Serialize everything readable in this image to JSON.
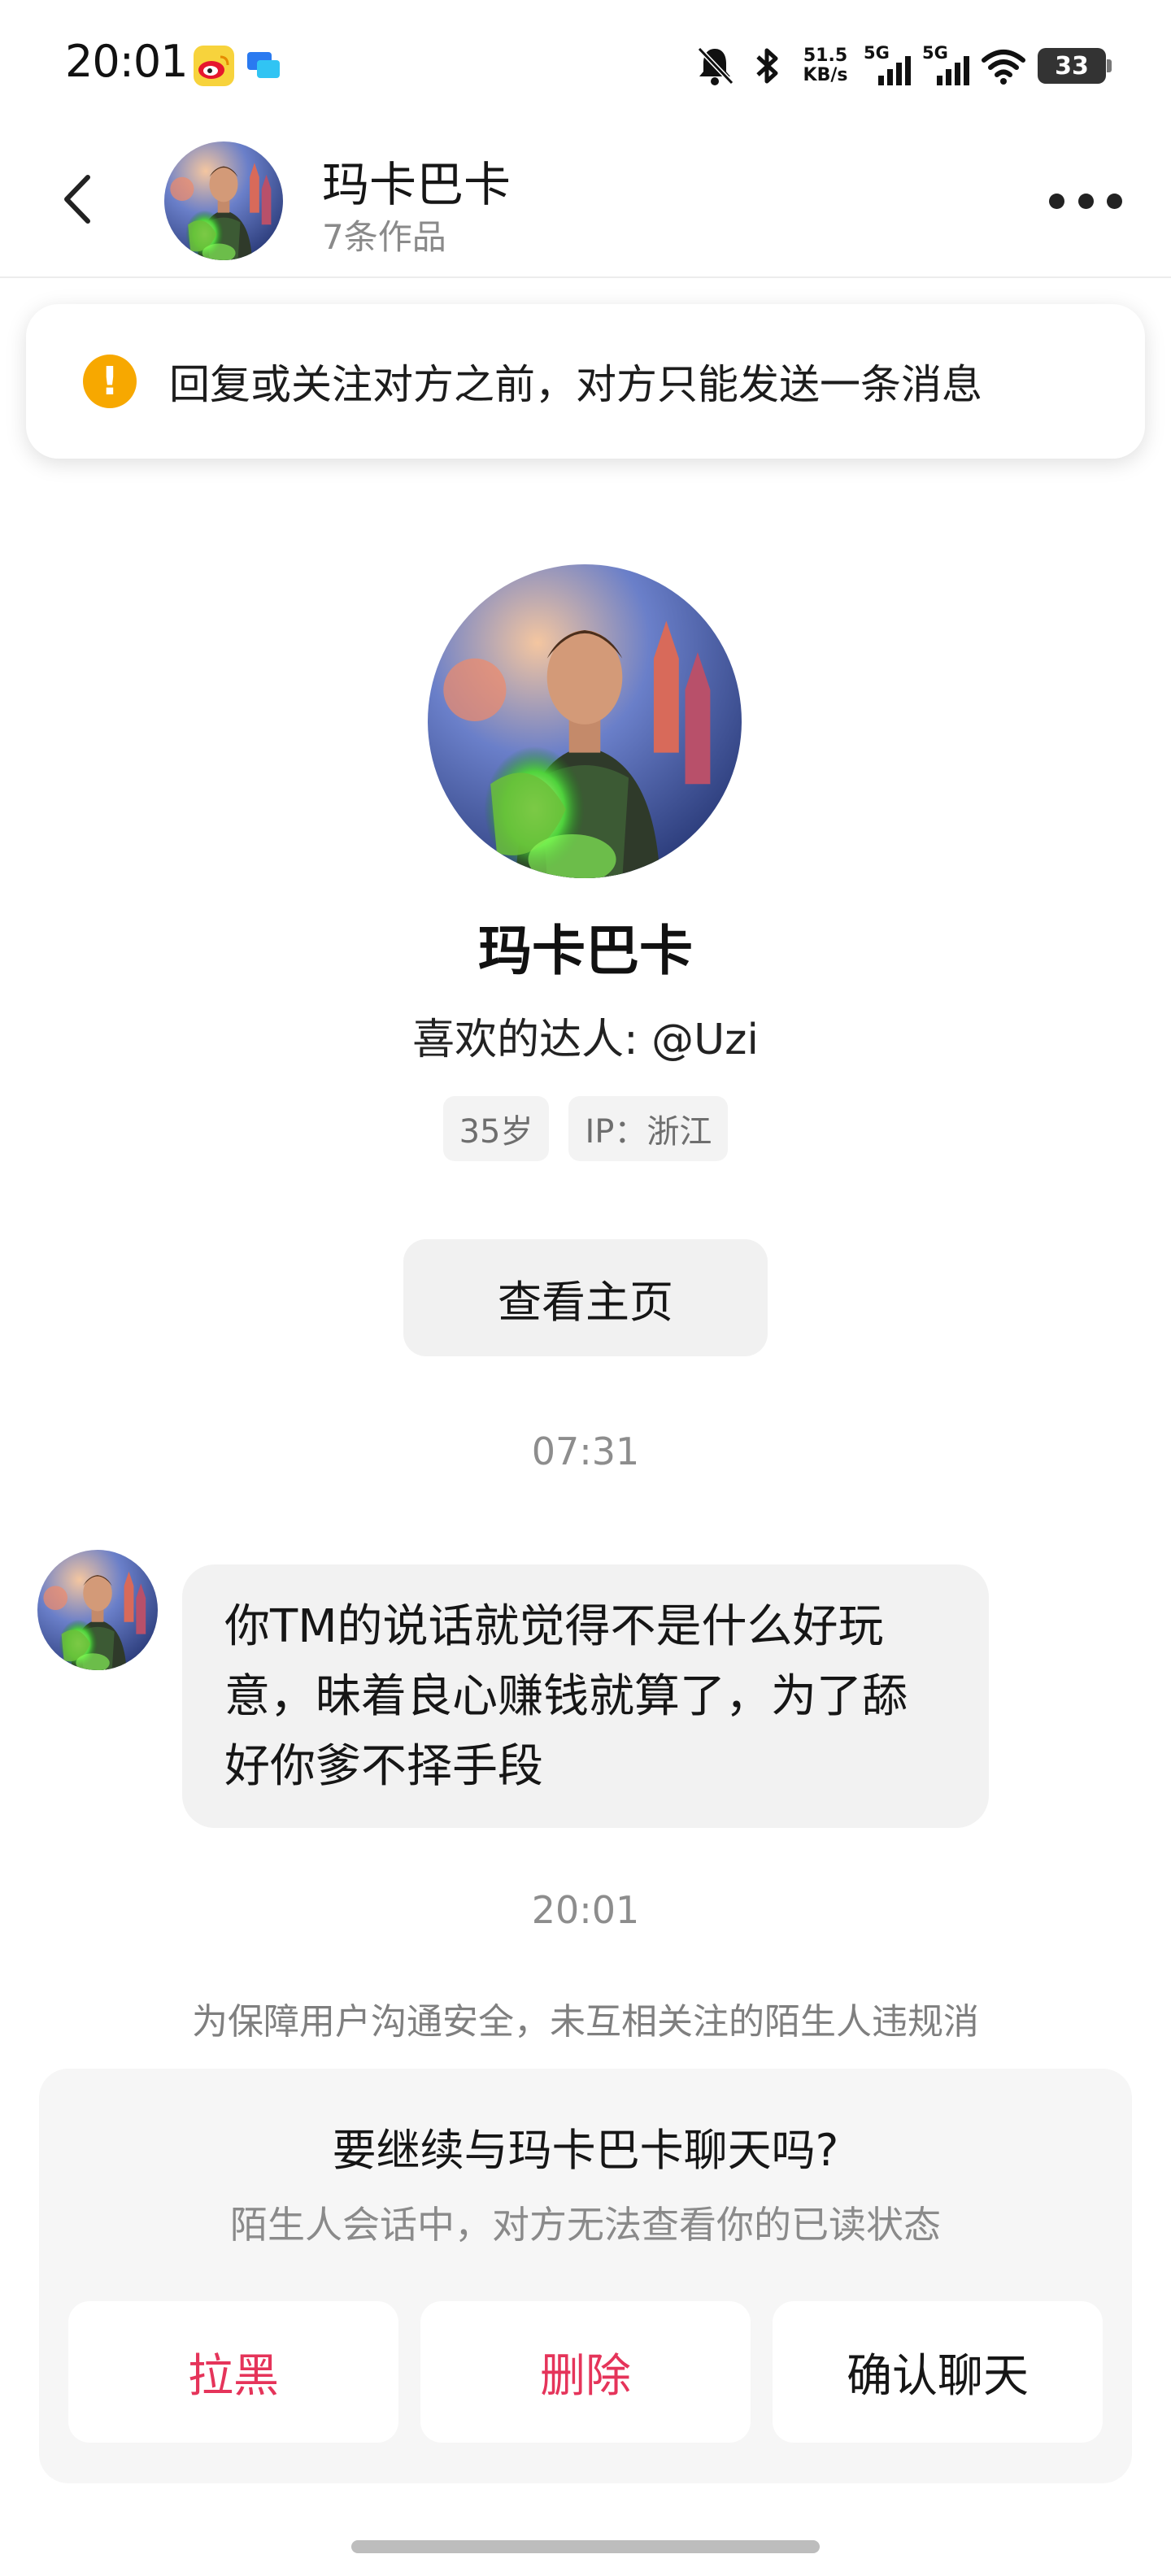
{
  "status_bar": {
    "time": "20:01",
    "net_speed_value": "51.5",
    "net_speed_unit": "KB/s",
    "signal1_label": "5G",
    "signal2_label": "5G",
    "battery": "33"
  },
  "header": {
    "name": "玛卡巴卡",
    "works": "7条作品"
  },
  "notice": {
    "icon": "!",
    "text": "回复或关注对方之前，对方只能发送一条消息"
  },
  "profile": {
    "name": "玛卡巴卡",
    "favorite": "喜欢的达人: @Uzi",
    "tags": [
      "35岁",
      "IP：浙江"
    ],
    "view_home": "查看主页"
  },
  "chat": {
    "time1": "07:31",
    "message": "你TM的说话就觉得不是什么好玩意，昧着良心赚钱就算了，为了舔好你爹不择手段",
    "time2": "20:01",
    "safety_notice": "为保障用户沟通安全，未互相关注的陌生人违规消"
  },
  "panel": {
    "title": "要继续与玛卡巴卡聊天吗?",
    "subtitle": "陌生人会话中，对方无法查看你的已读状态",
    "block": "拉黑",
    "delete": "删除",
    "confirm": "确认聊天"
  },
  "colors": {
    "danger": "#e5345a",
    "warning": "#f7a800"
  }
}
